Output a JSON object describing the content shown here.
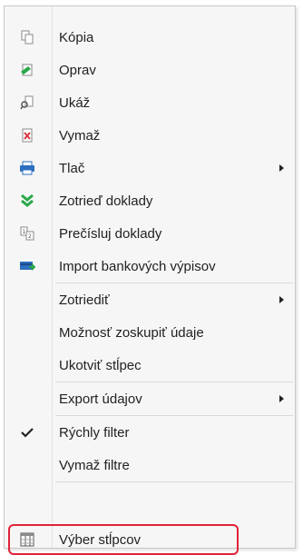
{
  "menu": {
    "items": [
      {
        "label": "Kópia",
        "icon": "copy-icon"
      },
      {
        "label": "Oprav",
        "icon": "edit-icon"
      },
      {
        "label": "Ukáž",
        "icon": "view-icon"
      },
      {
        "label": "Vymaž",
        "icon": "delete-icon"
      },
      {
        "label": "Tlač",
        "icon": "printer-icon",
        "submenu": true
      },
      {
        "label": "Zotrieď doklady",
        "icon": "sort-down-icon"
      },
      {
        "label": "Prečísluj doklady",
        "icon": "renumber-icon"
      },
      {
        "label": "Import bankových výpisov",
        "icon": "bank-import-icon"
      },
      {
        "label": "Zotriediť",
        "submenu": true
      },
      {
        "label": "Možnosť zoskupiť údaje"
      },
      {
        "label": "Ukotviť stĺpec"
      },
      {
        "label": "Export údajov",
        "submenu": true
      },
      {
        "label": "Rýchly filter",
        "checked": true
      },
      {
        "label": "Vymaž filtre"
      },
      {
        "label": "Výber stĺpcov",
        "icon": "columns-icon",
        "highlighted": true
      }
    ]
  },
  "colors": {
    "menu_bg": "#f6f6f6",
    "highlight_border": "#e0223a",
    "green_icon": "#2aa84a",
    "blue_icon": "#2d6fbf",
    "red_icon": "#d9363e"
  }
}
